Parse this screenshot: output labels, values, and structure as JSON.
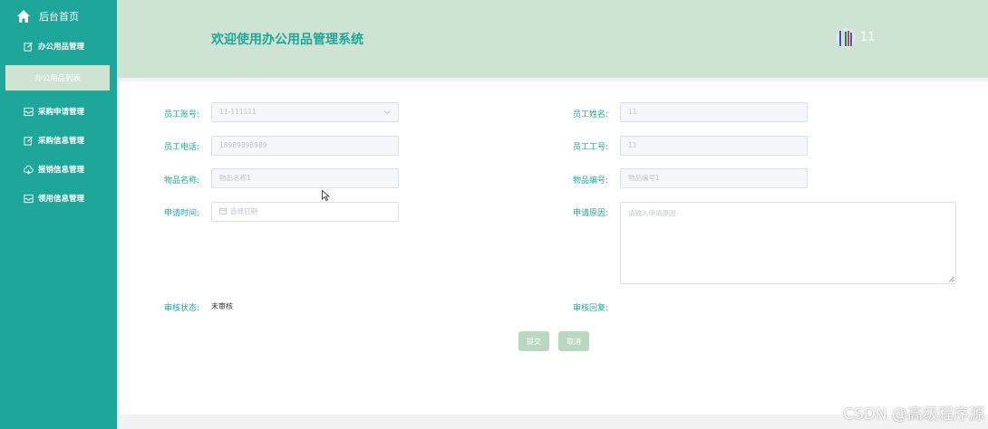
{
  "sidebar": {
    "home": {
      "label": "后台首页",
      "icon": "home-icon"
    },
    "items": [
      {
        "label": "办公用品管理",
        "icon": "edit-icon"
      },
      {
        "label": "采购申请管理",
        "icon": "inbox-icon"
      },
      {
        "label": "采购信息管理",
        "icon": "edit-icon"
      },
      {
        "label": "报销信息管理",
        "icon": "cloud-icon"
      },
      {
        "label": "领用信息管理",
        "icon": "inbox-icon"
      }
    ],
    "active_sub": {
      "label": "办公用品列表"
    }
  },
  "header": {
    "title": "欢迎使用办公用品管理系统",
    "username": "11"
  },
  "form": {
    "account": {
      "label": "员工账号:",
      "value": "11-111111"
    },
    "name": {
      "label": "员工姓名:",
      "value": "11"
    },
    "phone": {
      "label": "员工电话:",
      "value": "18989898989"
    },
    "employee_no": {
      "label": "员工工号:",
      "value": "11"
    },
    "item_name": {
      "label": "物品名称:",
      "value": "物品名称1"
    },
    "item_no": {
      "label": "物品编号:",
      "value": "物品编号1"
    },
    "apply_time": {
      "label": "申请时间:",
      "placeholder": "选择日期"
    },
    "reason": {
      "label": "申请原因:",
      "placeholder": "请输入申请原因"
    },
    "audit_status": {
      "label": "审核状态:",
      "value": "未审核"
    },
    "audit_reply": {
      "label": "审核回复:"
    }
  },
  "buttons": {
    "submit": "提交",
    "cancel": "取消"
  },
  "watermark": "CSDN @高级程序源",
  "colors": {
    "accent": "#1ea69a",
    "header_bg": "#cfe3d2",
    "button_bg": "#b8d9c0"
  }
}
